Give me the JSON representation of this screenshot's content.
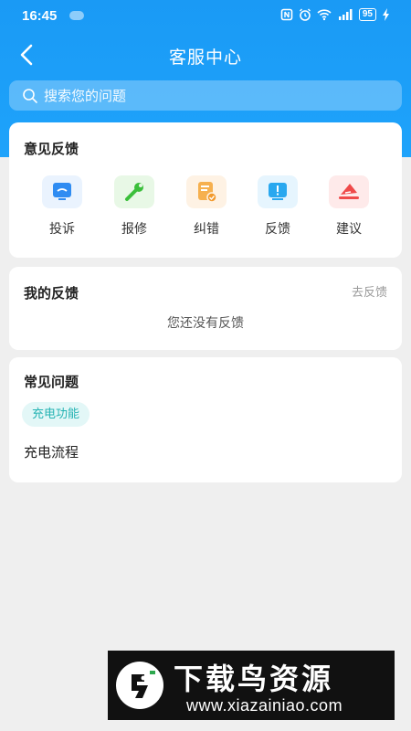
{
  "status_bar": {
    "time": "16:45",
    "battery": "95"
  },
  "header": {
    "title": "客服中心"
  },
  "search": {
    "placeholder": "搜索您的问题"
  },
  "feedback": {
    "title": "意见反馈",
    "items": [
      {
        "label": "投诉",
        "icon": "complaint-icon",
        "color": "#2f8cf2"
      },
      {
        "label": "报修",
        "icon": "wrench-icon",
        "color": "#3bbf3b"
      },
      {
        "label": "纠错",
        "icon": "correction-icon",
        "color": "#f29a2e"
      },
      {
        "label": "反馈",
        "icon": "feedback-icon",
        "color": "#29a8ef"
      },
      {
        "label": "建议",
        "icon": "suggestion-icon",
        "color": "#ef4a4a"
      }
    ]
  },
  "my_feedback": {
    "title": "我的反馈",
    "action": "去反馈",
    "empty_text": "您还没有反馈"
  },
  "faq": {
    "title": "常见问题",
    "tag": "充电功能",
    "items": [
      "充电流程"
    ]
  },
  "watermark": {
    "title": "下载鸟资源",
    "url": "www.xiazainiao.com"
  }
}
